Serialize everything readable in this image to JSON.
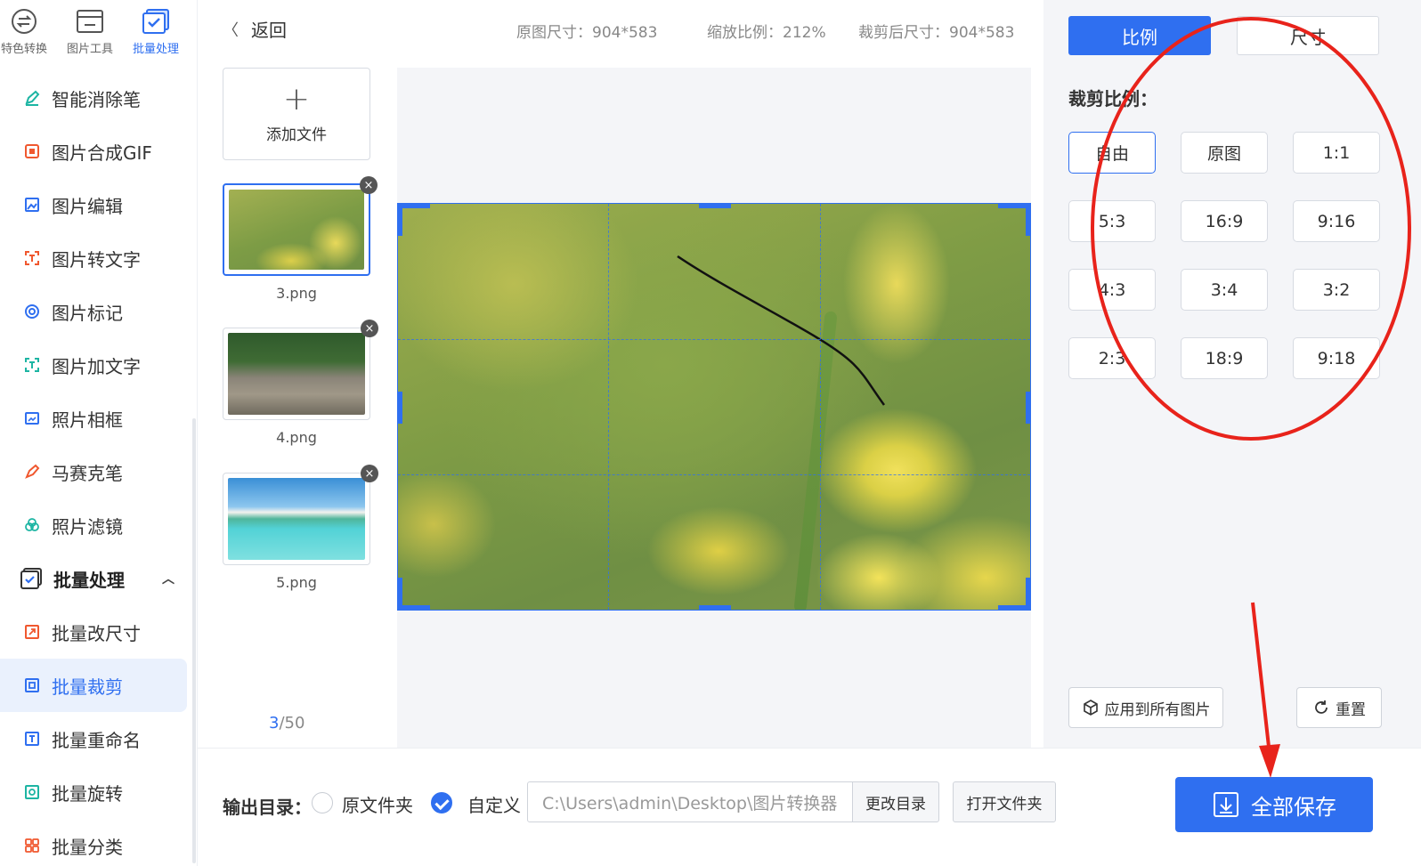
{
  "top_tabs": [
    {
      "label": "特色转换",
      "icon": "convert-icon"
    },
    {
      "label": "图片工具",
      "icon": "image-tool-icon"
    },
    {
      "label": "批量处理",
      "icon": "batch-icon"
    }
  ],
  "nav": {
    "items": [
      {
        "label": "智能消除笔",
        "icon": "eraser-pen-icon"
      },
      {
        "label": "图片合成GIF",
        "icon": "gif-icon"
      },
      {
        "label": "图片编辑",
        "icon": "image-edit-icon"
      },
      {
        "label": "图片转文字",
        "icon": "ocr-icon"
      },
      {
        "label": "图片标记",
        "icon": "mark-icon"
      },
      {
        "label": "图片加文字",
        "icon": "add-text-icon"
      },
      {
        "label": "照片相框",
        "icon": "frame-icon"
      },
      {
        "label": "马赛克笔",
        "icon": "mosaic-icon"
      },
      {
        "label": "照片滤镜",
        "icon": "filter-icon"
      }
    ],
    "section": {
      "label": "批量处理",
      "icon": "batch-section-icon"
    },
    "sub_items": [
      {
        "label": "批量改尺寸",
        "icon": "resize-icon"
      },
      {
        "label": "批量裁剪",
        "icon": "crop-icon",
        "active": true
      },
      {
        "label": "批量重命名",
        "icon": "rename-icon"
      },
      {
        "label": "批量旋转",
        "icon": "rotate-icon"
      },
      {
        "label": "批量分类",
        "icon": "classify-icon"
      }
    ]
  },
  "header": {
    "back": "返回",
    "original_size": "原图尺寸：904*583",
    "zoom": "缩放比例：212%",
    "cropped_size": "裁剪后尺寸：904*583"
  },
  "files": {
    "add_label": "添加文件",
    "items": [
      {
        "name": "3.png",
        "selected": true
      },
      {
        "name": "4.png",
        "selected": false
      },
      {
        "name": "5.png",
        "selected": false
      }
    ],
    "counter_current": "3",
    "counter_total": "/50"
  },
  "right_panel": {
    "tab_ratio": "比例",
    "tab_size": "尺寸",
    "title": "裁剪比例：",
    "ratios": [
      "自由",
      "原图",
      "1:1",
      "5:3",
      "16:9",
      "9:16",
      "4:3",
      "3:4",
      "3:2",
      "2:3",
      "18:9",
      "9:18"
    ],
    "active_ratio": "自由",
    "apply_all": "应用到所有图片",
    "reset": "重置"
  },
  "bottom": {
    "output_label": "输出目录：",
    "option_original": "原文件夹",
    "option_custom": "自定义",
    "custom_selected": true,
    "path_value": "C:\\Users\\admin\\Desktop\\图片转换器",
    "change_dir": "更改目录",
    "open_folder": "打开文件夹",
    "save_all": "全部保存"
  },
  "colors": {
    "accent": "#2f6ff0",
    "annotation": "#e8231b"
  }
}
